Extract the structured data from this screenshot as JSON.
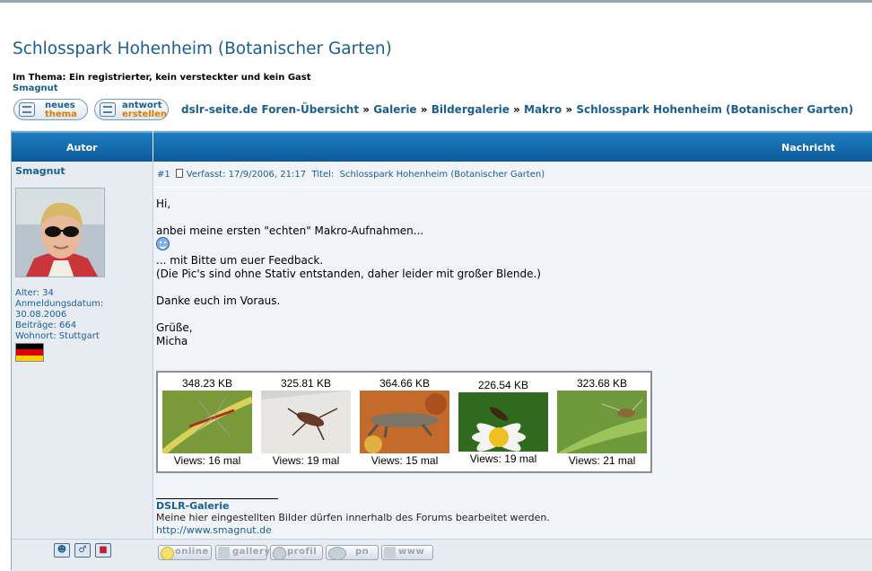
{
  "page": {
    "title": "Schlosspark Hohenheim (Botanischer Garten)",
    "viewers_line": "Im Thema: Ein registrierter, kein versteckter und kein Gast",
    "viewer_name": "Smagnut"
  },
  "buttons": {
    "new_topic": {
      "line1": "neues",
      "line2": "thema"
    },
    "reply": {
      "line1": "antwort",
      "line2": "erstellen"
    }
  },
  "breadcrumb": {
    "items": [
      "dslr-seite.de Foren-Übersicht",
      "Galerie",
      "Bildergalerie",
      "Makro",
      "Schlosspark Hohenheim (Botanischer Garten)"
    ],
    "separator": "»"
  },
  "table_header": {
    "author": "Autor",
    "message": "Nachricht"
  },
  "author": {
    "name": "Smagnut",
    "age": "Alter: 34",
    "joined_label": "Anmeldungsdatum:",
    "joined_date": "30.08.2006",
    "posts": "Beiträge: 664",
    "location": "Wohnort: Stuttgart",
    "flag_colors": [
      "#000000",
      "#dd0000",
      "#ffce00"
    ]
  },
  "post": {
    "number": "#1",
    "posted": "Verfasst: 17/9/2006, 21:17",
    "title_label": "Titel:",
    "title": "Schlosspark Hohenheim (Botanischer Garten)",
    "lines": {
      "greeting": "Hi,",
      "l1": "anbei meine ersten \"echten\" Makro-Aufnahmen...",
      "l2": "... mit Bitte um euer Feedback.",
      "l3": "(Die Pic's sind ohne Stativ entstanden, daher leider mit großer Blende.)",
      "l4": "Danke euch im Voraus.",
      "l5": "Grüße,",
      "l6": "Micha"
    }
  },
  "gallery": [
    {
      "size": "348.23 KB",
      "views": "Views: 16 mal"
    },
    {
      "size": "325.81 KB",
      "views": "Views: 19 mal"
    },
    {
      "size": "364.66 KB",
      "views": "Views: 15 mal"
    },
    {
      "size": "226.54 KB",
      "views": "Views: 19 mal"
    },
    {
      "size": "323.68 KB",
      "views": "Views: 21 mal"
    }
  ],
  "signature": {
    "title": "DSLR-Galerie",
    "text": "Meine hier eingestellten Bilder dürfen innerhalb des Forums bearbeitet werden.",
    "link": "http://www.smagnut.de"
  },
  "footer": {
    "icons": [
      "profile-icon",
      "male-icon",
      "car-icon"
    ],
    "buttons": [
      "online",
      "gallery",
      "profil",
      "pn",
      "www"
    ]
  },
  "colors": {
    "link": "#1a5f8f",
    "header": "#0d5a9a",
    "accent": "#e07b00"
  }
}
